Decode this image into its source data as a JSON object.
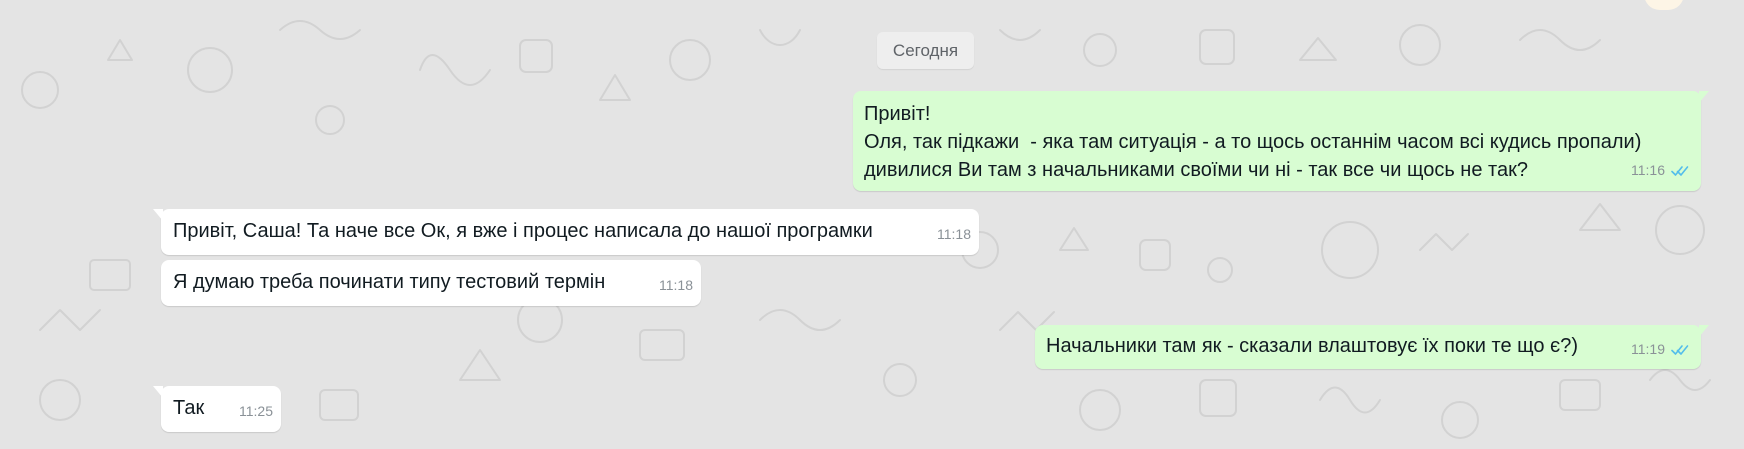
{
  "chat": {
    "date_separator": "Сегодня",
    "messages": [
      {
        "direction": "outgoing",
        "lines": [
          "Привіт!",
          "Оля, так підкажи  - яка там ситуація - а то щось останнім часом всі кудись пропали)",
          "дивилися Ви там з начальниками своїми чи ні - так все чи щось не так?"
        ],
        "time": "11:16",
        "status": "read"
      },
      {
        "direction": "incoming",
        "text": "Привіт, Саша! Та наче все Ок, я вже і процес написала до нашої програмки",
        "time": "11:18"
      },
      {
        "direction": "incoming",
        "text": "Я думаю треба починати типу тестовий термін",
        "time": "11:18"
      },
      {
        "direction": "outgoing",
        "text": "Начальники там як - сказали влаштовує їх поки те що є?)",
        "time": "11:19",
        "status": "read"
      },
      {
        "direction": "incoming",
        "text": "Так",
        "time": "11:25"
      }
    ]
  },
  "colors": {
    "outgoing_bubble": "#d8fdd2",
    "incoming_bubble": "#ffffff",
    "read_check": "#53bdeb",
    "background": "#e4e4e4"
  },
  "icons": {
    "read_receipt": "double-check-icon"
  }
}
